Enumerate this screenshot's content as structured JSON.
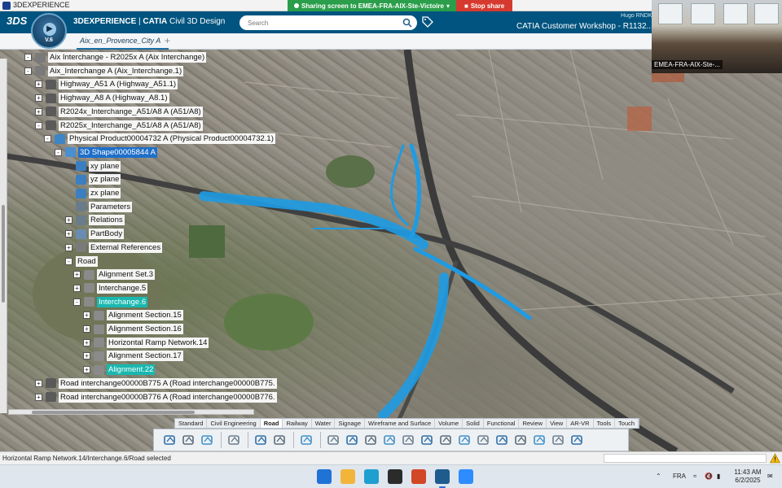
{
  "window": {
    "title": "3DEXPERIENCE"
  },
  "share_banner": {
    "sharing_text": "Sharing screen to EMEA-FRA-AIX-Ste-Victoire",
    "stop_label": "Stop share"
  },
  "header": {
    "brand_3dx": "3DEXPERIENCE",
    "brand_catia": "CATIA",
    "brand_app": "Civil 3D Design",
    "compass_version": "V.6",
    "search_placeholder": "Search",
    "user_name": "Hugo RNDK",
    "workshop_title": "CATIA Customer Workshop - R1132..."
  },
  "tabs": {
    "active": "Aix_en_Provence_City A",
    "add": "+"
  },
  "tree": {
    "items": [
      {
        "label": "Aix Interchange - R2025x A (Aix Interchange)",
        "level": 0,
        "expander": "-",
        "icon_color": "#7a7a7a"
      },
      {
        "label": "Aix_Interchange A (Aix_Interchange.1)",
        "level": 0,
        "expander": "-",
        "icon_color": "#7a7a7a"
      },
      {
        "label": "Highway_A51 A (Highway_A51.1)",
        "level": 1,
        "expander": "+",
        "icon_color": "#5a5a5a"
      },
      {
        "label": "Highway_A8 A (Highway_A8.1)",
        "level": 1,
        "expander": "+",
        "icon_color": "#5a5a5a"
      },
      {
        "label": "R2024x_Interchange_A51/A8 A (A51/A8)",
        "level": 1,
        "expander": "+",
        "icon_color": "#5a5a5a"
      },
      {
        "label": "R2025x_Interchange_A51/A8 A (A51/A8)",
        "level": 1,
        "expander": "-",
        "icon_color": "#5a5a5a"
      },
      {
        "label": "Physical Product00004732 A (Physical Product00004732.1)",
        "level": 2,
        "expander": "-",
        "icon_color": "#3d86c6"
      },
      {
        "label": "3D Shape00005844 A",
        "level": 3,
        "expander": "-",
        "icon_color": "#4a8fcf",
        "state": "selected"
      },
      {
        "label": "xy plane",
        "level": 4,
        "expander": "",
        "icon_color": "#3b7fc0"
      },
      {
        "label": "yz plane",
        "level": 4,
        "expander": "",
        "icon_color": "#3b7fc0"
      },
      {
        "label": "zx plane",
        "level": 4,
        "expander": "",
        "icon_color": "#3b7fc0"
      },
      {
        "label": "Parameters",
        "level": 4,
        "expander": "",
        "icon_color": "#6a7c8a"
      },
      {
        "label": "Relations",
        "level": 4,
        "expander": "+",
        "icon_color": "#6a7c8a"
      },
      {
        "label": "PartBody",
        "level": 4,
        "expander": "+",
        "icon_color": "#6a8cb0"
      },
      {
        "label": "External References",
        "level": 4,
        "expander": "+",
        "icon_color": "#7a7a7a"
      },
      {
        "label": "Road",
        "level": 4,
        "expander": "-",
        "icon_color": ""
      },
      {
        "label": "Alignment Set.3",
        "level": 5,
        "expander": "+",
        "icon_color": "#8a8a8a"
      },
      {
        "label": "Interchange.5",
        "level": 5,
        "expander": "+",
        "icon_color": "#8a8a8a"
      },
      {
        "label": "Interchange.6",
        "level": 5,
        "expander": "-",
        "icon_color": "#8a8a8a",
        "state": "highlighted"
      },
      {
        "label": "Alignment Section.15",
        "level": 6,
        "expander": "+",
        "icon_color": "#8a8a8a"
      },
      {
        "label": "Alignment Section.16",
        "level": 6,
        "expander": "+",
        "icon_color": "#8a8a8a"
      },
      {
        "label": "Horizontal Ramp Network.14",
        "level": 6,
        "expander": "+",
        "icon_color": "#8a8a8a"
      },
      {
        "label": "Alignment Section.17",
        "level": 6,
        "expander": "+",
        "icon_color": "#8a8a8a"
      },
      {
        "label": "Alignment.22",
        "level": 6,
        "expander": "+",
        "icon_color": "#8a8a8a",
        "state": "highlighted"
      },
      {
        "label": "Road interchange00000B775 A (Road interchange00000B775.",
        "level": 1,
        "expander": "+",
        "icon_color": "#5a5a5a"
      },
      {
        "label": "Road interchange00000B776 A (Road interchange00000B776.",
        "level": 1,
        "expander": "+",
        "icon_color": "#5a5a5a"
      }
    ]
  },
  "action_bar": {
    "tabs": [
      "Standard",
      "Civil Engineering",
      "Road",
      "Railway",
      "Water",
      "Signage",
      "Wireframe and Surface",
      "Volume",
      "Solid",
      "Functional",
      "Review",
      "View",
      "AR-VR",
      "Tools",
      "Touch"
    ],
    "active_tab": "Road",
    "icons": [
      "cut-icon",
      "copy-icon",
      "paste-icon",
      "undo-icon",
      "zoom-icon",
      "book-icon",
      "refresh-icon",
      "alignment-icon",
      "profile-icon",
      "terrain-icon",
      "corridor-icon",
      "road-surface-icon",
      "bridge-icon",
      "ramp-icon",
      "slope-icon",
      "marking-icon",
      "grid-icon",
      "network-icon",
      "building-icon",
      "cube-icon",
      "box-icon"
    ]
  },
  "status": {
    "text": "Horizontal Ramp Network.14/Interchange.6/Road selected"
  },
  "taskbar": {
    "apps": [
      {
        "name": "windows-start-icon",
        "color": "#1f72d6",
        "active": false
      },
      {
        "name": "file-explorer-icon",
        "color": "#f2b53a",
        "active": false
      },
      {
        "name": "edge-browser-icon",
        "color": "#1f9ed0",
        "active": false
      },
      {
        "name": "terminal-icon",
        "color": "#2b2b2b",
        "active": false
      },
      {
        "name": "powerpoint-icon",
        "color": "#d24726",
        "active": false
      },
      {
        "name": "3dexperience-app-icon",
        "color": "#1d5c8d",
        "active": true
      },
      {
        "name": "zoom-app-icon",
        "color": "#2d8cff",
        "active": false
      }
    ],
    "language": "FRA",
    "time": "11:43 AM",
    "date": "6/2/2025"
  },
  "video": {
    "participant": "EMEA-FRA-AIX-Ste-..."
  },
  "colors": {
    "header_bg": "#00547f",
    "road_blue": "#1e9be3",
    "selection_blue": "#1f6fc9",
    "highlight_teal": "#19b8b0"
  }
}
